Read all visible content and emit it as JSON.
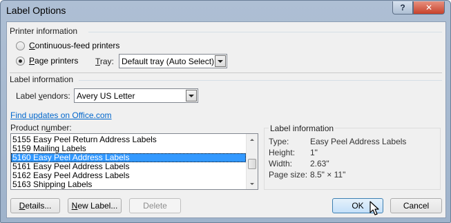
{
  "window": {
    "title": "Label Options",
    "help_symbol": "?",
    "close_symbol": "✕"
  },
  "printer_info": {
    "heading": "Printer information",
    "continuous_prefix": "",
    "continuous_mnemonic": "C",
    "continuous_rest": "ontinuous-feed printers",
    "page_printers_prefix": "",
    "page_printers_mnemonic": "P",
    "page_printers_rest": "age printers",
    "selected": "page",
    "tray_label_mnemonic": "T",
    "tray_label_rest": "ray:",
    "tray_value": "Default tray (Auto Select)"
  },
  "label_info_section": {
    "heading": "Label information",
    "vendors_label_prefix": "Label ",
    "vendors_label_mnemonic": "v",
    "vendors_label_rest": "endors:",
    "vendors_value": "Avery US Letter",
    "updates_link": "Find updates on Office.com",
    "product_number_prefix": "Product n",
    "product_number_mnemonic": "u",
    "product_number_rest": "mber:"
  },
  "product_list": {
    "items": [
      "5155 Easy Peel Return Address Labels",
      "5159 Mailing Labels",
      "5160 Easy Peel Address Labels",
      "5161 Easy Peel Address Labels",
      "5162 Easy Peel Address Labels",
      "5163 Shipping Labels"
    ],
    "selected_index": 2
  },
  "label_details": {
    "heading": "Label information",
    "rows": [
      {
        "key": "Type:",
        "value": "Easy Peel Address Labels"
      },
      {
        "key": "Height:",
        "value": "1\""
      },
      {
        "key": "Width:",
        "value": "2.63\""
      },
      {
        "key": "Page size:",
        "value": "8.5\" × 11\""
      }
    ]
  },
  "buttons": {
    "details_mnemonic": "D",
    "details_rest": "etails...",
    "new_label_mnemonic": "N",
    "new_label_rest": "ew Label...",
    "delete": "Delete",
    "ok": "OK",
    "cancel": "Cancel"
  },
  "colors": {
    "link": "#0066cc",
    "selection": "#3399ff",
    "default_button_border": "#3c7fb1"
  }
}
